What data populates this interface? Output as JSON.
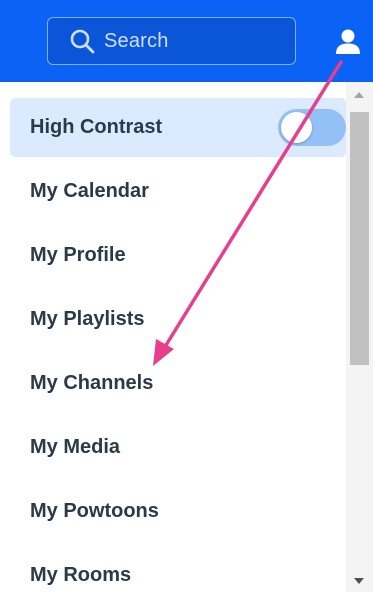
{
  "search": {
    "placeholder": "Search",
    "icon": "search-icon"
  },
  "header": {
    "user_icon": "user-icon",
    "bar_color": "#0b63f6"
  },
  "menu": {
    "items": [
      {
        "label": "High Contrast",
        "toggle": {
          "on": false
        }
      },
      {
        "label": "My Calendar"
      },
      {
        "label": "My Profile"
      },
      {
        "label": "My Playlists"
      },
      {
        "label": "My Channels"
      },
      {
        "label": "My Media"
      },
      {
        "label": "My Powtoons"
      },
      {
        "label": "My Rooms"
      }
    ],
    "highlight_color": "#dbeafe"
  },
  "annotation": {
    "arrow_color": "#e83e8c"
  }
}
